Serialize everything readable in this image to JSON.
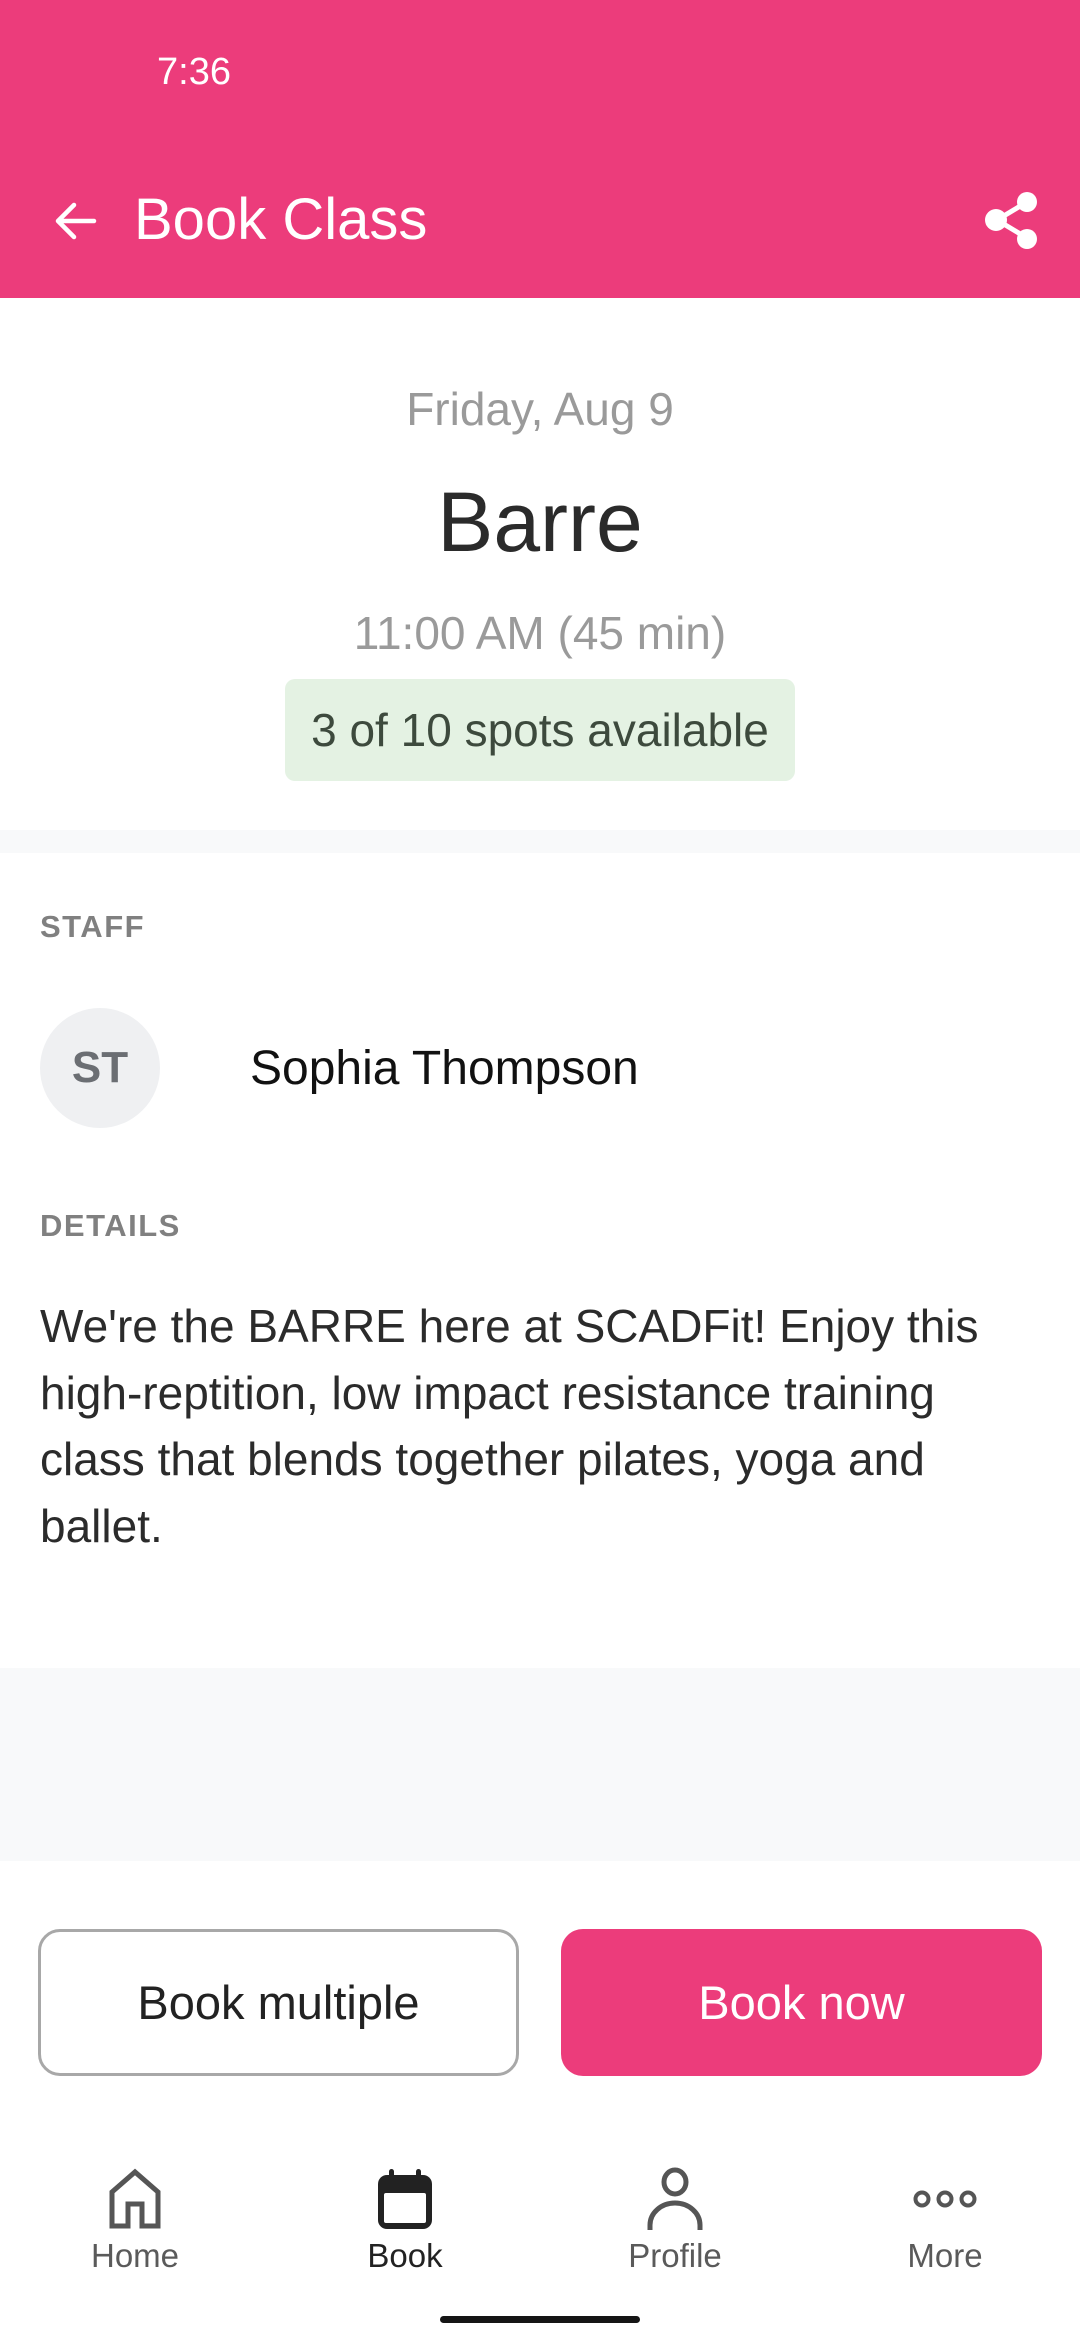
{
  "status_bar": {
    "time": "7:36"
  },
  "header": {
    "title": "Book Class",
    "back_icon": "arrow-left-icon",
    "share_icon": "share-icon",
    "background_color": "#ec3c7b"
  },
  "class_info": {
    "date": "Friday, Aug 9",
    "name": "Barre",
    "time": "11:00 AM (45 min)",
    "availability": "3 of 10 spots available",
    "spots_available": 3,
    "spots_total": 10
  },
  "staff": {
    "section_label": "STAFF",
    "initials": "ST",
    "name": "Sophia Thompson"
  },
  "details": {
    "section_label": "DETAILS",
    "description": "We're the BARRE here at SCADFit! Enjoy this high-reptition, low impact resistance training class that blends together pilates, yoga and ballet."
  },
  "actions": {
    "book_multiple_label": "Book multiple",
    "book_now_label": "Book now",
    "primary_color": "#ec3c7b"
  },
  "bottom_nav": {
    "active": "Book",
    "items": [
      {
        "label": "Home",
        "icon": "home-icon"
      },
      {
        "label": "Book",
        "icon": "calendar-icon"
      },
      {
        "label": "Profile",
        "icon": "person-icon"
      },
      {
        "label": "More",
        "icon": "more-dots-icon"
      }
    ]
  }
}
